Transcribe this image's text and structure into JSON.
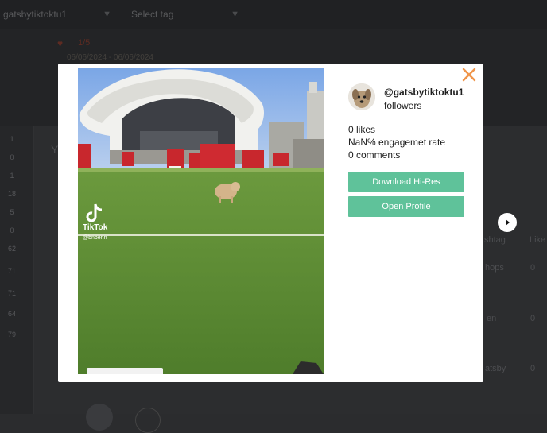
{
  "background": {
    "account_select": "gatsbytiktoktu1",
    "tag_select": "Select tag",
    "count_text": "1/5",
    "date_range": "06/06/2024 - 06/06/2024",
    "left_numbers": [
      "1",
      "0",
      "1",
      "18",
      "5",
      "0",
      "62",
      "71",
      "71",
      "64",
      "79"
    ],
    "section_heading": "Y",
    "col_hashtag": "shtag",
    "col_likes": "Like",
    "rows": [
      {
        "tag": "hops",
        "likes": "0"
      },
      {
        "tag": "en",
        "likes": "0"
      },
      {
        "tag": "atsby",
        "likes": "0"
      }
    ]
  },
  "modal": {
    "video": {
      "watermark_brand": "TikTok",
      "watermark_user": "@bnbenn"
    },
    "profile": {
      "handle": "@gatsbytiktoktu1",
      "followers_label": "followers"
    },
    "stats": {
      "likes": "0 likes",
      "engagement": "NaN% engagemet rate",
      "comments": "0 comments"
    },
    "buttons": {
      "download": "Download Hi-Res",
      "open_profile": "Open Profile"
    }
  },
  "colors": {
    "accent_green": "#5fc29a",
    "close_orange": "#f0954a"
  },
  "icons": {
    "close": "close-icon",
    "next": "chevron-right-icon"
  }
}
